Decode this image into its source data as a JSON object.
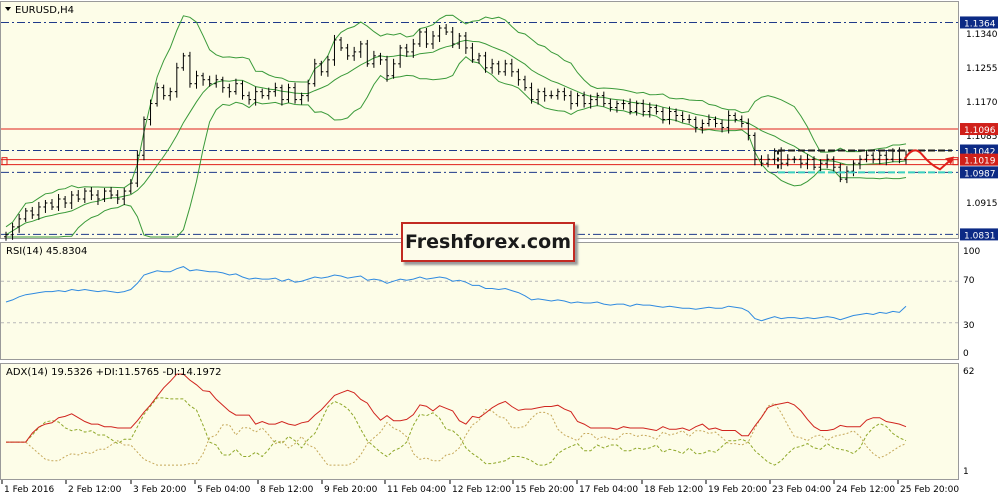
{
  "colors": {
    "panel_bg": "#fdfde8",
    "candle": "#000000",
    "bollinger": "#3a9a3a",
    "resistance_line": "#e0201a",
    "level_line": "#1f3a8a",
    "rsi_line": "#2f8ae0",
    "adx_line": "#d0241e",
    "di_plus": "#8fa82a",
    "di_minus": "#c6a85a",
    "forecast_arrow": "#e0201a",
    "range_box": "#1a1a1a",
    "range_base": "#3ad0c0",
    "price_tag_blue": "#0c2a85",
    "price_tag_red": "#d0201a"
  },
  "main_panel": {
    "title": "EURUSD,H4",
    "axis_labels": [
      "1.1340",
      "1.1255",
      "1.1170",
      "1.1085",
      "1.0915"
    ],
    "tags": [
      {
        "text": "1.1364",
        "style": "blue"
      },
      {
        "text": "1.1096",
        "style": "red"
      },
      {
        "text": "1.1042",
        "style": "blue"
      },
      {
        "text": "1.1019",
        "style": "red"
      },
      {
        "text": "1.0987",
        "style": "blue"
      },
      {
        "text": "1.0831",
        "style": "blue"
      }
    ]
  },
  "rsi_panel": {
    "title": "RSI(14) 45.8304",
    "axis_labels": [
      "100",
      "70",
      "30",
      "0"
    ]
  },
  "adx_panel": {
    "title": "ADX(14) 19.5326 +DI:11.5765 -DI:14.1972",
    "axis_labels": [
      "62",
      "1"
    ]
  },
  "x_axis": [
    "1 Feb 2016",
    "2 Feb 12:00",
    "3 Feb 20:00",
    "5 Feb 04:00",
    "8 Feb 12:00",
    "9 Feb 20:00",
    "11 Feb 04:00",
    "12 Feb 12:00",
    "15 Feb 20:00",
    "17 Feb 04:00",
    "18 Feb 12:00",
    "19 Feb 20:00",
    "23 Feb 04:00",
    "24 Feb 12:00",
    "25 Feb 20:00"
  ],
  "brand": "Freshforex.com",
  "chart_data": [
    {
      "type": "candlestick",
      "title": "EURUSD,H4",
      "price_levels": [
        1.1364,
        1.1096,
        1.1042,
        1.1019,
        1.0987,
        1.0831
      ],
      "close": [
        1.083,
        1.085,
        1.087,
        1.089,
        1.088,
        1.09,
        1.091,
        1.09,
        1.092,
        1.091,
        1.093,
        1.092,
        1.094,
        1.093,
        1.092,
        1.094,
        1.093,
        1.092,
        1.094,
        1.096,
        1.103,
        1.112,
        1.116,
        1.12,
        1.118,
        1.119,
        1.125,
        1.128,
        1.121,
        1.123,
        1.122,
        1.121,
        1.122,
        1.12,
        1.119,
        1.121,
        1.118,
        1.117,
        1.119,
        1.118,
        1.119,
        1.12,
        1.117,
        1.12,
        1.117,
        1.118,
        1.121,
        1.126,
        1.124,
        1.127,
        1.132,
        1.13,
        1.128,
        1.129,
        1.131,
        1.126,
        1.128,
        1.127,
        1.123,
        1.126,
        1.13,
        1.129,
        1.131,
        1.134,
        1.131,
        1.133,
        1.135,
        1.134,
        1.131,
        1.133,
        1.13,
        1.127,
        1.128,
        1.125,
        1.126,
        1.124,
        1.126,
        1.124,
        1.122,
        1.12,
        1.117,
        1.119,
        1.118,
        1.118,
        1.119,
        1.118,
        1.116,
        1.118,
        1.116,
        1.117,
        1.118,
        1.116,
        1.115,
        1.116,
        1.116,
        1.114,
        1.116,
        1.114,
        1.115,
        1.114,
        1.112,
        1.114,
        1.113,
        1.112,
        1.112,
        1.11,
        1.111,
        1.112,
        1.111,
        1.11,
        1.113,
        1.112,
        1.111,
        1.108,
        1.102,
        1.101,
        1.102,
        1.104,
        1.101,
        1.102,
        1.102,
        1.101,
        1.102,
        1.1,
        1.101,
        1.102,
        1.1,
        1.097,
        1.099,
        1.101,
        1.102,
        1.103,
        1.102,
        1.103,
        1.102,
        1.104,
        1.102,
        1.103
      ],
      "rsi": [
        50,
        52,
        55,
        57,
        58,
        59,
        60,
        60,
        61,
        60,
        62,
        61,
        62,
        61,
        60,
        61,
        60,
        59,
        60,
        62,
        68,
        76,
        78,
        80,
        79,
        79,
        82,
        84,
        80,
        81,
        80,
        79,
        79,
        78,
        76,
        77,
        74,
        72,
        73,
        72,
        72,
        73,
        70,
        72,
        69,
        70,
        72,
        74,
        73,
        74,
        76,
        75,
        73,
        74,
        75,
        71,
        72,
        71,
        68,
        70,
        72,
        71,
        72,
        74,
        72,
        73,
        74,
        73,
        70,
        71,
        69,
        66,
        66,
        63,
        63,
        62,
        63,
        61,
        59,
        56,
        52,
        53,
        52,
        51,
        52,
        51,
        49,
        50,
        49,
        49,
        50,
        48,
        47,
        48,
        48,
        46,
        48,
        47,
        47,
        46,
        45,
        46,
        45,
        44,
        44,
        43,
        44,
        45,
        44,
        44,
        46,
        45,
        44,
        41,
        34,
        32,
        34,
        36,
        34,
        35,
        35,
        34,
        35,
        34,
        35,
        36,
        35,
        33,
        35,
        37,
        38,
        39,
        38,
        40,
        39,
        41,
        40,
        46
      ]
    }
  ]
}
